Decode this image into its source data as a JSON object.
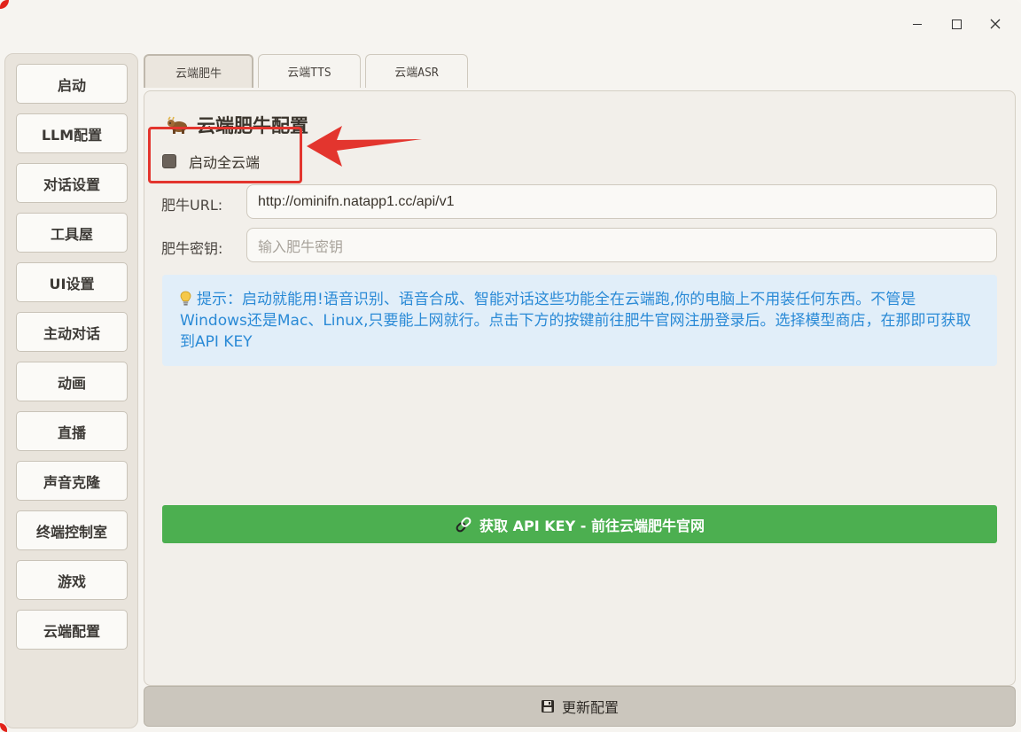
{
  "sidebar": {
    "items": [
      {
        "label": "启动"
      },
      {
        "label": "LLM配置"
      },
      {
        "label": "对话设置"
      },
      {
        "label": "工具屋"
      },
      {
        "label": "UI设置"
      },
      {
        "label": "主动对话"
      },
      {
        "label": "动画"
      },
      {
        "label": "直播"
      },
      {
        "label": "声音克隆"
      },
      {
        "label": "终端控制室"
      },
      {
        "label": "游戏"
      },
      {
        "label": "云端配置"
      }
    ]
  },
  "tabs": [
    {
      "label": "云端肥牛",
      "active": true
    },
    {
      "label": "云端TTS",
      "active": false
    },
    {
      "label": "云端ASR",
      "active": false
    }
  ],
  "section": {
    "title": "云端肥牛配置",
    "icon": "cow-icon"
  },
  "checkbox": {
    "label": "启动全云端",
    "checked": false
  },
  "fields": {
    "url": {
      "label": "肥牛URL:",
      "value": "http://ominifn.natapp1.cc/api/v1"
    },
    "key": {
      "label": "肥牛密钥:",
      "placeholder": "输入肥牛密钥"
    }
  },
  "tip": {
    "text": "提示：启动就能用!语音识别、语音合成、智能对话这些功能全在云端跑,你的电脑上不用装任何东西。不管是Windows还是Mac、Linux,只要能上网就行。点击下方的按键前往肥牛官网注册登录后。选择模型商店，在那即可获取到API KEY"
  },
  "apikey_button": {
    "label": "获取 API KEY - 前往云端肥牛官网"
  },
  "update_button": {
    "label": "更新配置"
  },
  "colors": {
    "accent_green": "#4caf50",
    "tip_blue": "#2a8ad6",
    "highlight_red": "#e3352e"
  }
}
